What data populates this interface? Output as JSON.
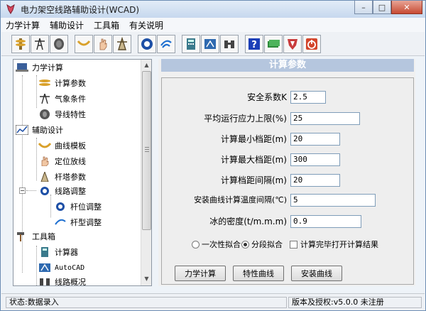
{
  "window": {
    "title": "电力架空线路辅助设计(WCAD)",
    "minimize": "–",
    "maximize": "□",
    "close": "✕"
  },
  "menu": [
    "力学计算",
    "辅助设计",
    "工具箱",
    "有关说明"
  ],
  "toolbar_icons": [
    "insulator-icon",
    "tower-icon",
    "cable-reel-icon",
    "curve-template-icon",
    "hand-icon",
    "tower-design-icon",
    "china-telecom-icon",
    "telecom-icon",
    "calculator-icon",
    "autocad-icon",
    "binoculars-icon",
    "help-icon",
    "money-icon",
    "badge-icon",
    "power-icon"
  ],
  "tree": {
    "mechanics": "力学计算",
    "calc_params": "计算参数",
    "weather": "气象条件",
    "wire_props": "导线特性",
    "aux_design": "辅助设计",
    "curve_template": "曲线模板",
    "position_line": "定位放线",
    "tower_params": "杆塔参数",
    "route_adjust": "线路调整",
    "pole_adjust": "杆位调整",
    "pole_type_adjust": "杆型调整",
    "toolbox": "工具箱",
    "calculator": "计算器",
    "autocad": "AutoCAD",
    "route_overview": "线路概况"
  },
  "panel": {
    "title": "计算参数",
    "fields": [
      {
        "label": "安全系数K",
        "value": "2.5"
      },
      {
        "label": "平均运行应力上限(%)",
        "value": "25"
      },
      {
        "label": "计算最小档距(m)",
        "value": "20"
      },
      {
        "label": "计算最大档距(m)",
        "value": "300"
      },
      {
        "label": "计算档距间隔(m)",
        "value": "20"
      },
      {
        "label": "安装曲线计算温度间隔(℃)",
        "value": "5"
      },
      {
        "label": "冰的密度(t/m.m.m)",
        "value": "0.9"
      }
    ],
    "radio_single": "一次性拟合",
    "radio_segment": "分段拟合",
    "radio_selected": "分段拟合",
    "checkbox_open": "计算完毕打开计算结果",
    "btn_mech": "力学计算",
    "btn_char": "特性曲线",
    "btn_install": "安装曲线"
  },
  "status": {
    "left": "状态:数据录入",
    "right": "版本及授权:v5.0.0 未注册"
  },
  "colors": {
    "header_bg": "#b5c6de",
    "title_bg": "#c6d8ee",
    "close_btn": "#c74a33"
  }
}
